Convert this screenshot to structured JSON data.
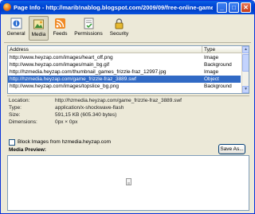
{
  "window": {
    "title": "Page Info - http://marib!nablog.blogspot.com/2009/09/free-online-games.htm...",
    "controls": {
      "minimize": "_",
      "maximize": "□",
      "close": "✕"
    }
  },
  "toolbar": {
    "items": [
      {
        "label": "General",
        "icon": "general-info-icon"
      },
      {
        "label": "Media",
        "icon": "media-icon",
        "selected": true
      },
      {
        "label": "Feeds",
        "icon": "feed-icon"
      },
      {
        "label": "Permissions",
        "icon": "permissions-icon"
      },
      {
        "label": "Security",
        "icon": "security-lock-icon"
      }
    ]
  },
  "media_table": {
    "columns": {
      "address": "Address",
      "type": "Type"
    },
    "rows": [
      {
        "address": "http://www.heyzap.com/images/heart_off.png",
        "type": "Image"
      },
      {
        "address": "http://www.heyzap.com/images/main_bg.gif",
        "type": "Background"
      },
      {
        "address": "http://hzmedia.heyzap.com/thumbnail_games_frizzle-fraz_12997.jpg",
        "type": "Image"
      },
      {
        "address": "http://hzmedia.heyzap.com/game_frizzle-fraz_3889.swf",
        "type": "Object",
        "selected": true
      },
      {
        "address": "http://www.heyzap.com/images/topslice_bg.png",
        "type": "Background"
      }
    ]
  },
  "details": {
    "location_label": "Location:",
    "location_value": "http://hzmedia.heyzap.com/game_frizzle-fraz_3889.swf",
    "type_label": "Type:",
    "type_value": "application/x-shockwave-flash",
    "size_label": "Size:",
    "size_value": "591,15 KB (605.340 bytes)",
    "dimensions_label": "Dimensions:",
    "dimensions_value": "0px × 0px"
  },
  "block_images_label": "Block Images from hzmedia.heyzap.com",
  "save_as_label": "Save As...",
  "media_preview_label": "Media Preview:",
  "colors": {
    "titlebar": "#0046d5",
    "selection": "#316ac5",
    "dialog_bg": "#ece9d8"
  }
}
